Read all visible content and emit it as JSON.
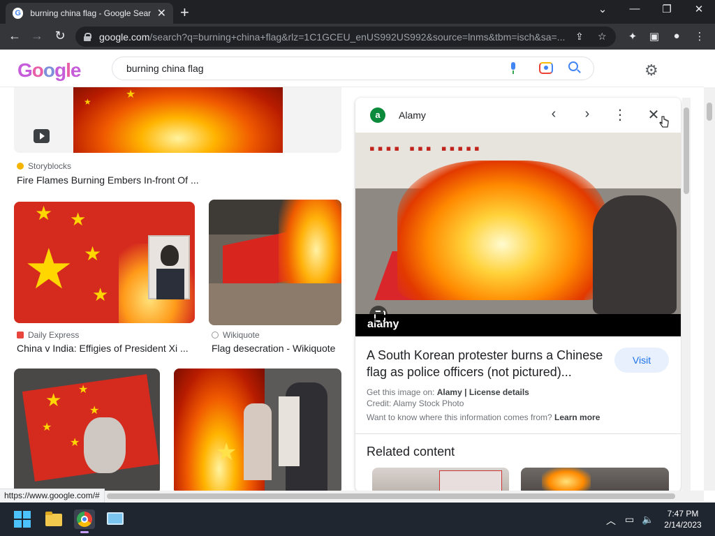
{
  "browser": {
    "tab_title": "burning china flag - Google Sear",
    "url_host": "google.com",
    "url_rest": "/search?q=burning+china+flag&rlz=1C1GCEU_enUS992US992&source=lnms&tbm=isch&sa=...",
    "status_url": "https://www.google.com/#"
  },
  "search": {
    "logo": [
      "G",
      "o",
      "o",
      "g",
      "l",
      "e"
    ],
    "query": "burning china flag"
  },
  "results": [
    {
      "source": "Storyblocks",
      "caption": "Fire Flames Burning Embers In-front Of ..."
    },
    {
      "source": "Daily Express",
      "caption": "China v India: Effigies of President Xi ..."
    },
    {
      "source": "Wikiquote",
      "caption": "Flag desecration - Wikiquote"
    }
  ],
  "panel": {
    "source_initial": "a",
    "source_name": "Alamy",
    "image_watermark": "alamy",
    "title": "A South Korean protester burns a Chinese flag as police officers (not pictured)...",
    "visit_label": "Visit",
    "meta_get_prefix": "Get this image on:",
    "meta_get_source": "Alamy",
    "meta_sep": "|",
    "meta_license": "License details",
    "meta_credit": "Credit: Alamy Stock Photo",
    "meta_info_prefix": "Want to know where this information comes from?",
    "meta_learn_more": "Learn more",
    "related_heading": "Related content"
  },
  "taskbar": {
    "time": "7:47 PM",
    "date": "2/14/2023"
  },
  "colors": {
    "accent": "#1a73e8",
    "flag_red": "#d52a1e",
    "star_yellow": "#ffd600"
  }
}
